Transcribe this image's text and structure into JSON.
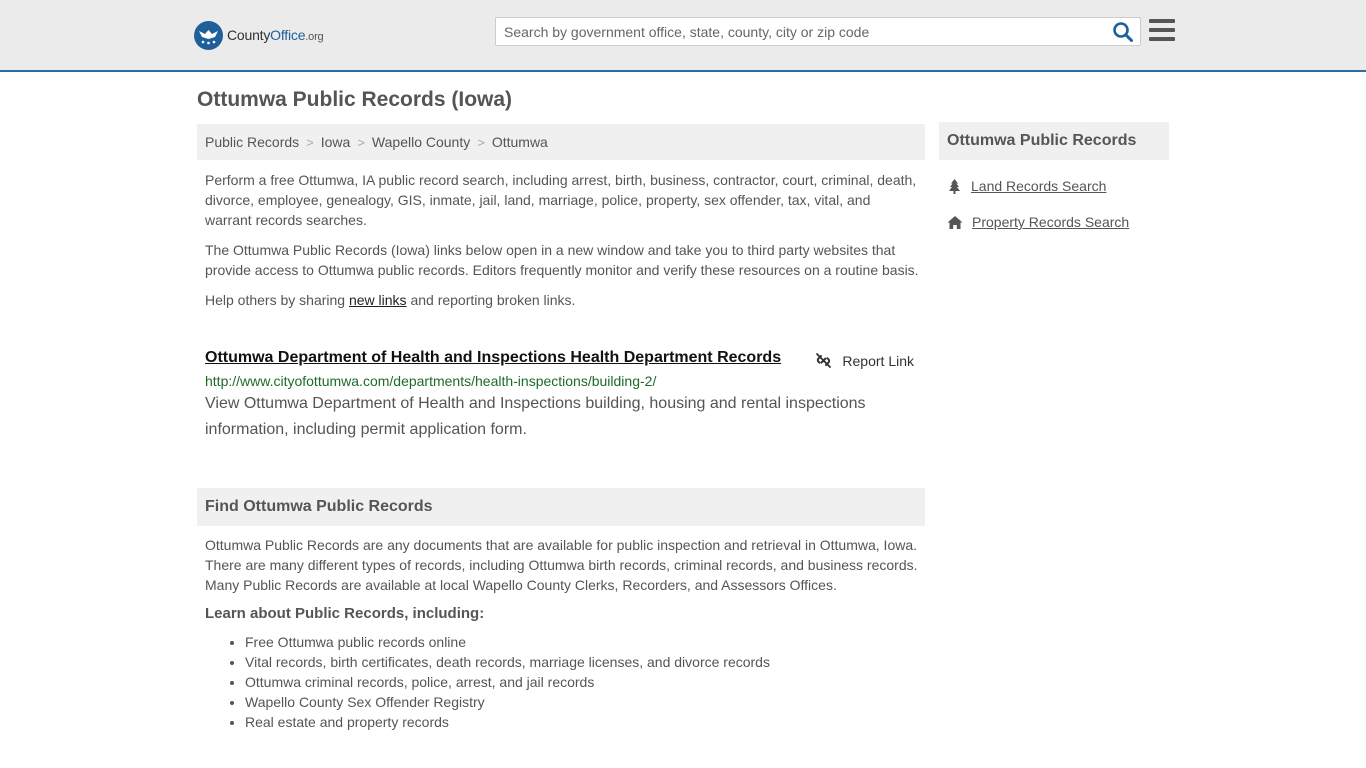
{
  "header": {
    "logo_county": "County",
    "logo_office": "Office",
    "logo_org": ".org",
    "search_placeholder": "Search by government office, state, county, city or zip code"
  },
  "page_title": "Ottumwa Public Records (Iowa)",
  "breadcrumb": [
    "Public Records",
    "Iowa",
    "Wapello County",
    "Ottumwa"
  ],
  "intro": {
    "p1": "Perform a free Ottumwa, IA public record search, including arrest, birth, business, contractor, court, criminal, death, divorce, employee, genealogy, GIS, inmate, jail, land, marriage, police, property, sex offender, tax, vital, and warrant records searches.",
    "p2": "The Ottumwa Public Records (Iowa) links below open in a new window and take you to third party websites that provide access to Ottumwa public records. Editors frequently monitor and verify these resources on a routine basis.",
    "p3_before": "Help others by sharing ",
    "p3_link": "new links",
    "p3_after": " and reporting broken links."
  },
  "record": {
    "title": "Ottumwa Department of Health and Inspections Health Department Records",
    "report_label": "Report Link",
    "url": "http://www.cityofottumwa.com/departments/health-inspections/building-2/",
    "description": "View Ottumwa Department of Health and Inspections building, housing and rental inspections information, including permit application form."
  },
  "find": {
    "heading": "Find Ottumwa Public Records",
    "body": "Ottumwa Public Records are any documents that are available for public inspection and retrieval in Ottumwa, Iowa. There are many different types of records, including Ottumwa birth records, criminal records, and business records. Many Public Records are available at local Wapello County Clerks, Recorders, and Assessors Offices.",
    "learn_heading": "Learn about Public Records, including:",
    "learn_items": [
      "Free Ottumwa public records online",
      "Vital records, birth certificates, death records, marriage licenses, and divorce records",
      "Ottumwa criminal records, police, arrest, and jail records",
      "Wapello County Sex Offender Registry",
      "Real estate and property records"
    ]
  },
  "sidebar": {
    "heading": "Ottumwa Public Records",
    "links": [
      "Land Records Search",
      "Property Records Search"
    ]
  },
  "colors": {
    "brand_blue": "#1f5f9a",
    "url_green": "#1d6b2a",
    "header_bg": "#ebebeb"
  }
}
